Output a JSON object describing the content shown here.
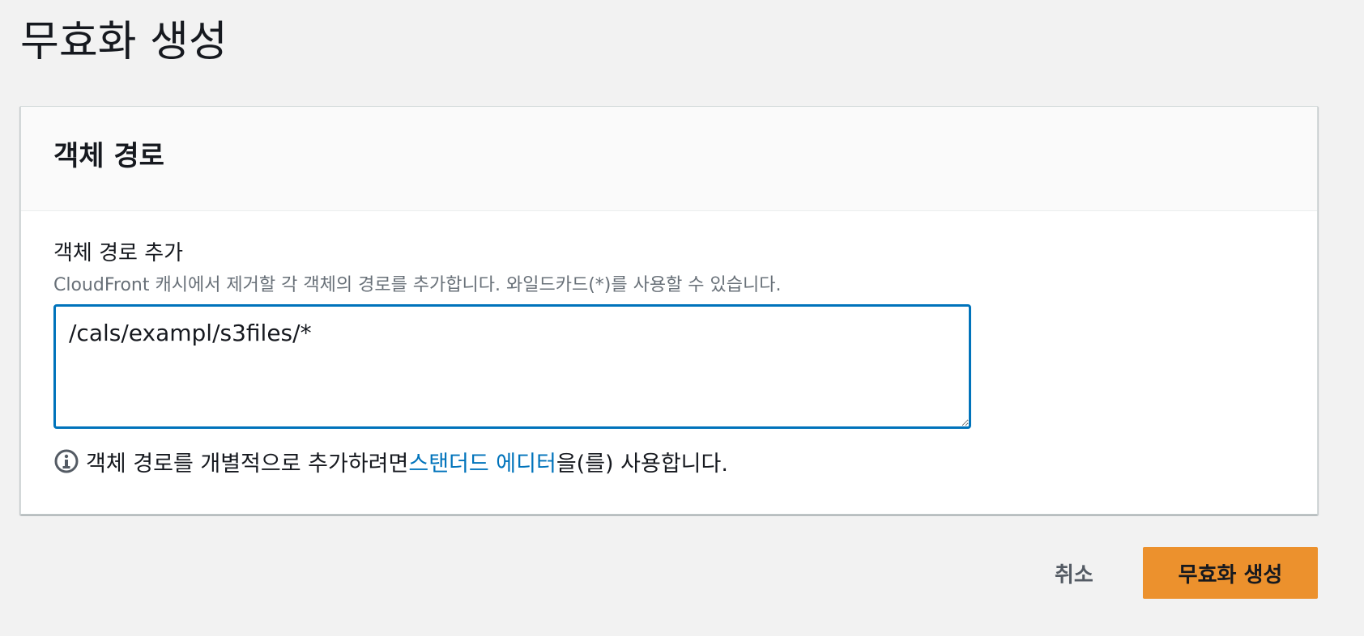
{
  "page": {
    "title": "무효화 생성"
  },
  "panel": {
    "title": "객체 경로",
    "field_label": "객체 경로 추가",
    "field_description": "CloudFront 캐시에서 제거할 각 객체의 경로를 추가합니다. 와일드카드(*)를 사용할 수 있습니다.",
    "path_value": "/cals/exampl/s3files/*",
    "info": {
      "icon": "info-circle-icon",
      "prefix": "객체 경로를 개별적으로 추가하려면 ",
      "link_text": "스탠더드 에디터",
      "suffix": "을(를) 사용합니다."
    }
  },
  "actions": {
    "cancel_label": "취소",
    "submit_label": "무효화 생성"
  },
  "colors": {
    "background": "#f2f2f2",
    "primary_button": "#ec912d",
    "link": "#0073bb",
    "focus_border": "#0073bb"
  }
}
